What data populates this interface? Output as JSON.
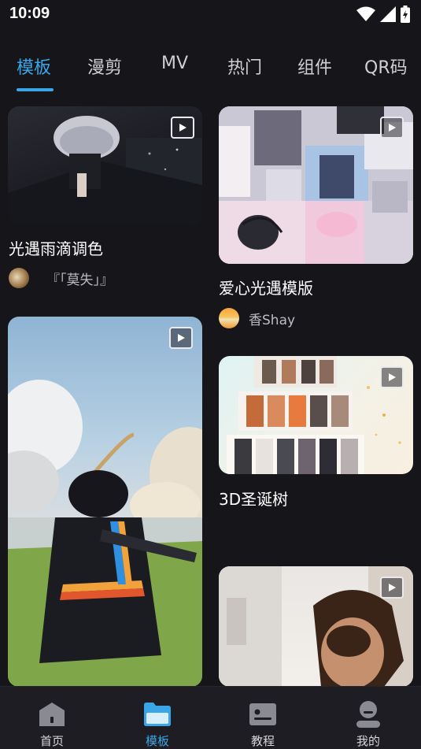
{
  "status_bar": {
    "time": "10:09"
  },
  "tabs": [
    {
      "label": "模板",
      "active": true
    },
    {
      "label": "漫剪",
      "active": false
    },
    {
      "label": "MV",
      "active": false
    },
    {
      "label": "热门",
      "active": false
    },
    {
      "label": "组件",
      "active": false
    },
    {
      "label": "QR码",
      "active": false
    }
  ],
  "cards": [
    {
      "title": "光遇雨滴调色",
      "author": "『「莫失」』"
    },
    {
      "title": "爱心光遇模版",
      "author": "香Shay"
    },
    {
      "title": "3D圣诞树",
      "author": ""
    },
    {
      "title": "",
      "author": ""
    },
    {
      "title": "",
      "author": ""
    }
  ],
  "bottom_nav": [
    {
      "label": "首页",
      "icon": "home-icon"
    },
    {
      "label": "模板",
      "icon": "template-folder-icon",
      "active": true
    },
    {
      "label": "教程",
      "icon": "tutorial-card-icon"
    },
    {
      "label": "我的",
      "icon": "profile-icon"
    }
  ],
  "colors": {
    "accent": "#3aa6e8",
    "background": "#15151a",
    "nav_background": "#1d1d23"
  }
}
